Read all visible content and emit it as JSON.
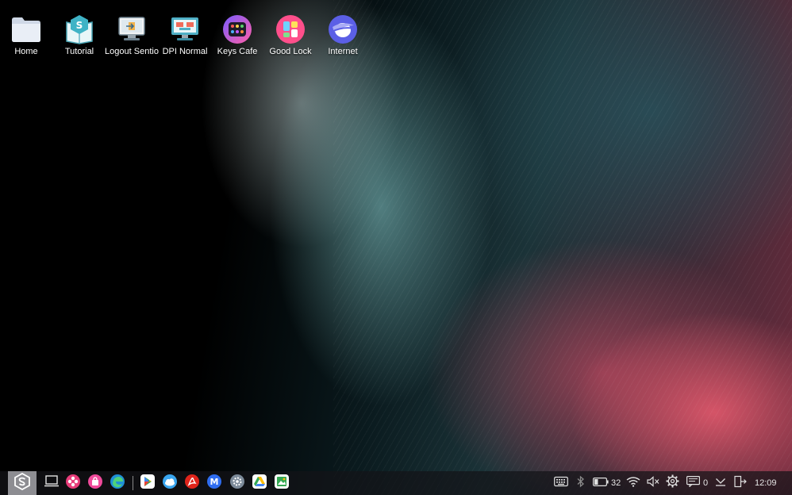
{
  "desktop": {
    "icons": [
      {
        "label": "Home",
        "icon": "folder-icon"
      },
      {
        "label": "Tutorial",
        "icon": "sentio-book-icon"
      },
      {
        "label": "Logout Sentio",
        "icon": "logout-monitor-icon"
      },
      {
        "label": "DPI Normal",
        "icon": "dpi-monitor-icon"
      },
      {
        "label": "Keys Cafe",
        "icon": "keys-cafe-icon"
      },
      {
        "label": "Good Lock",
        "icon": "good-lock-icon"
      },
      {
        "label": "Internet",
        "icon": "internet-icon"
      }
    ]
  },
  "taskbar": {
    "start_icon": "sentio-logo-icon",
    "apps": [
      {
        "name": "screen-app",
        "icon": "laptop-icon"
      },
      {
        "name": "flower-app",
        "icon": "flower-icon"
      },
      {
        "name": "store-app",
        "icon": "shopping-bag-icon"
      },
      {
        "name": "edge-browser",
        "icon": "edge-icon"
      },
      {
        "name": "play-store",
        "icon": "play-store-icon"
      },
      {
        "name": "weather-app",
        "icon": "weather-cloud-icon"
      },
      {
        "name": "acrobat-app",
        "icon": "acrobat-icon"
      },
      {
        "name": "m-app",
        "icon": "m-letter-icon"
      },
      {
        "name": "settings-app",
        "icon": "gear-icon"
      },
      {
        "name": "google-drive",
        "icon": "drive-icon"
      },
      {
        "name": "gallery-app",
        "icon": "gallery-icon"
      }
    ],
    "tray": {
      "battery_level": "32",
      "notification_count": "0",
      "clock": "12:09"
    }
  },
  "colors": {
    "taskbar_bg": "#141418",
    "start_button": "#8d8d92",
    "label_text": "#ffffff"
  }
}
